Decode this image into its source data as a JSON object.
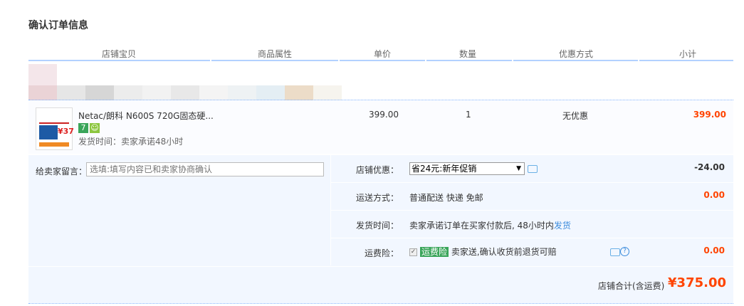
{
  "page_title": "确认订单信息",
  "header": [
    "店铺宝贝",
    "商品属性",
    "单价",
    "数量",
    "优惠方式",
    "小计"
  ],
  "item": {
    "name": "Netac/朗科 N600S 720G固态硬...",
    "badge1": "7",
    "shipping": "发货时间：卖家承诺48小时",
    "price": "399.00",
    "quantity": "1",
    "discount": "无优惠",
    "subtotal": "399.00",
    "thumb_text": "¥37"
  },
  "message": {
    "label": "给卖家留言：",
    "placeholder": "选填:填写内容已和卖家协商确认"
  },
  "shop_discount": {
    "label": "店铺优惠：",
    "selected": "省24元:新年促销",
    "amount": "-24.00"
  },
  "delivery": {
    "label": "运送方式：",
    "value": "普通配送 快递 免邮",
    "amount": "0.00"
  },
  "ship_time": {
    "label": "发货时间：",
    "value": "卖家承诺订单在买家付款后, 48小时内",
    "link": "发货"
  },
  "insurance": {
    "label": "运费险：",
    "tag": "运费险",
    "value": "卖家送,确认收货前退货可赔",
    "amount": "0.00"
  },
  "total": {
    "label": "店铺合计(含运费)",
    "amount": "¥375.00"
  },
  "colors": {
    "accent": "#ff4400",
    "header_line": "#b2d1ff",
    "panel_bg": "#f2f7ff"
  }
}
